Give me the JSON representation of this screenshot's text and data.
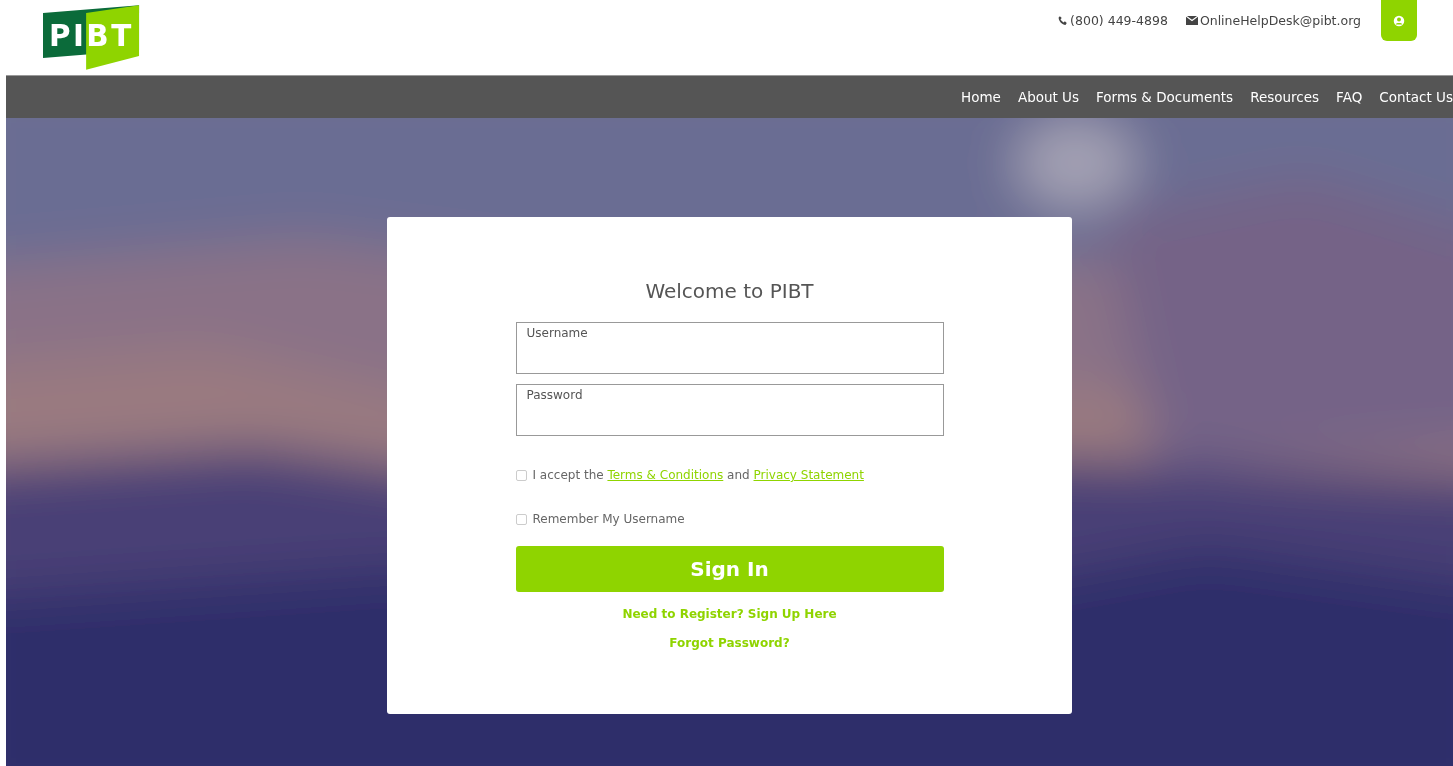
{
  "header": {
    "logo": "PIBT",
    "phone": "(800) 449-4898",
    "email": "OnlineHelpDesk@pibt.org"
  },
  "nav": [
    "Home",
    "About Us",
    "Forms & Documents",
    "Resources",
    "FAQ",
    "Contact Us"
  ],
  "login": {
    "title": "Welcome to PIBT",
    "fields": [
      {
        "label": "Username"
      },
      {
        "label": "Password"
      }
    ],
    "checkboxes": [
      {
        "kind": "terms",
        "before": "I accept the",
        "link1": "Terms & Conditions",
        "middle": "and",
        "link2": "Privacy Statement",
        "checked": false
      },
      {
        "kind": "plain",
        "label": "Remember My Username",
        "checked": false
      }
    ],
    "button": "Sign In",
    "register_link": "Need to Register? Sign Up Here",
    "forgot_link": "Forgot Password?"
  }
}
